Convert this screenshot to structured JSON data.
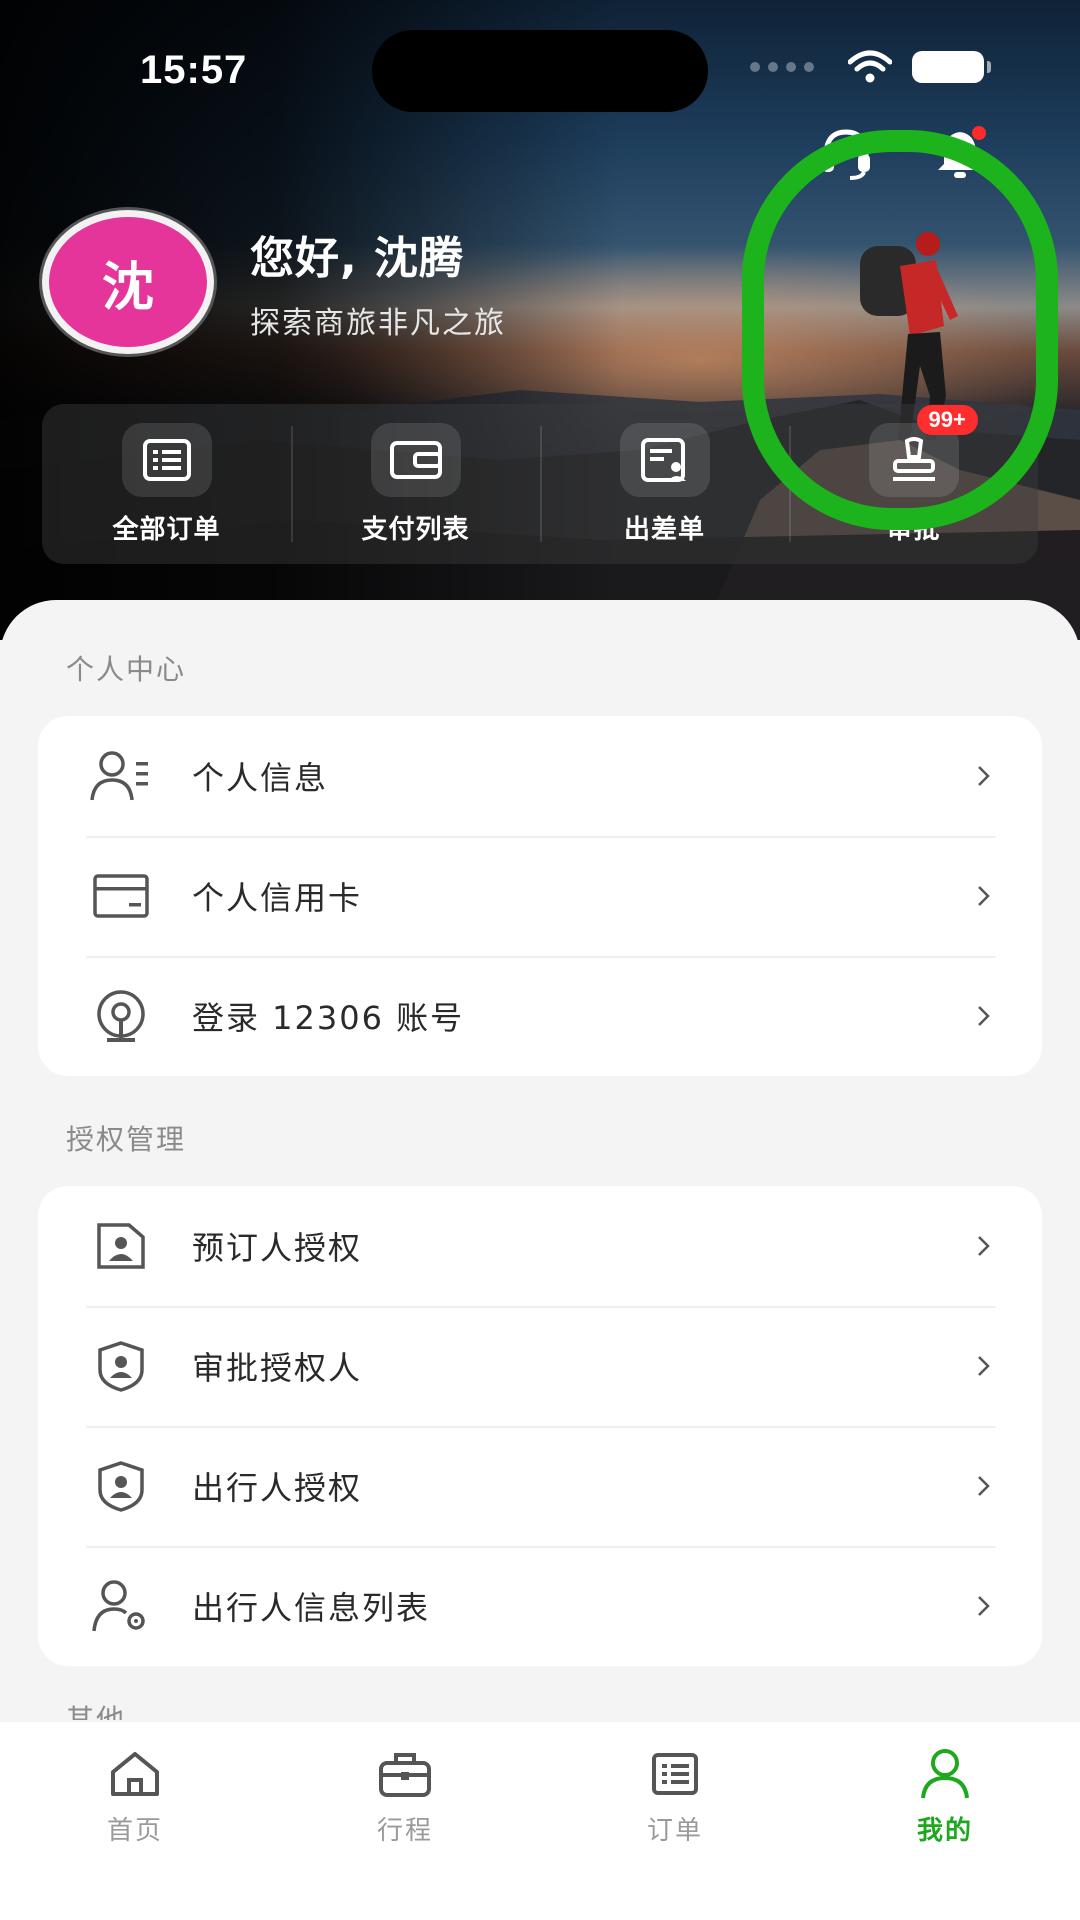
{
  "status_bar": {
    "time": "15:57"
  },
  "profile": {
    "avatar_text": "沈",
    "greeting": "您好, 沈腾",
    "subtitle": "探索商旅非凡之旅"
  },
  "quick_actions": [
    {
      "label": "全部订单",
      "icon": "order-list-icon"
    },
    {
      "label": "支付列表",
      "icon": "wallet-icon"
    },
    {
      "label": "出差单",
      "icon": "business-trip-form-icon"
    },
    {
      "label": "审批",
      "icon": "approval-stamp-icon",
      "badge": "99+"
    }
  ],
  "personal_center": {
    "title": "个人中心",
    "items": [
      {
        "label": "个人信息",
        "icon": "user-info-icon"
      },
      {
        "label": "个人信用卡",
        "icon": "credit-card-icon"
      },
      {
        "label": "登录 12306 账号",
        "icon": "railway-icon"
      }
    ]
  },
  "authorization": {
    "title": "授权管理",
    "items": [
      {
        "label": "预订人授权",
        "icon": "booker-id-icon"
      },
      {
        "label": "审批授权人",
        "icon": "approver-shield-icon"
      },
      {
        "label": "出行人授权",
        "icon": "traveler-shield-icon"
      },
      {
        "label": "出行人信息列表",
        "icon": "traveler-settings-icon"
      }
    ]
  },
  "other_section": {
    "title": "其他"
  },
  "tabbar": [
    {
      "label": "首页",
      "icon": "home-icon",
      "active": false
    },
    {
      "label": "行程",
      "icon": "briefcase-icon",
      "active": false
    },
    {
      "label": "订单",
      "icon": "order-icon",
      "active": false
    },
    {
      "label": "我的",
      "icon": "profile-icon",
      "active": true
    }
  ],
  "colors": {
    "accent": "#1ea81e",
    "avatar": "#e5359b",
    "badge": "#ff2d2d",
    "frame": "#1db31d"
  }
}
